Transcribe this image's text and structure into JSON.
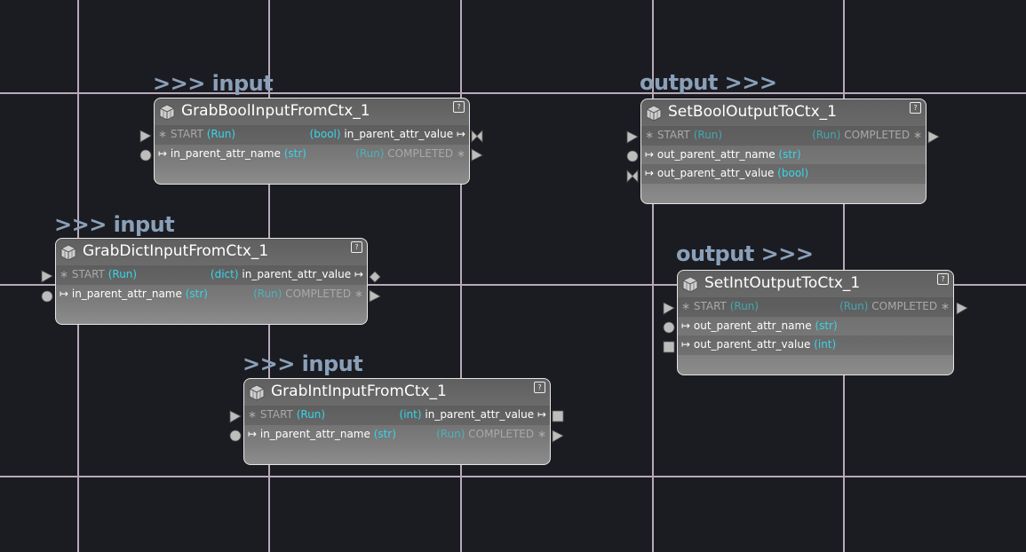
{
  "grid": {
    "color": "#b8a9ba",
    "background": "#1b1c22"
  },
  "nodes": [
    {
      "badge": ">>> input",
      "title": "GrabBoolInputFromCtx_1",
      "rows": [
        {
          "in_a": "∗ START",
          "in_b": "(Run)",
          "out_a": "(bool)",
          "out_b": "in_parent_attr_value ↦"
        },
        {
          "in_a": "↦ in_parent_attr_name",
          "in_b": "(str)",
          "out_a": "(Run)",
          "out_b": "COMPLETED ∗"
        }
      ]
    },
    {
      "badge": ">>> input",
      "title": "GrabDictInputFromCtx_1",
      "rows": [
        {
          "in_a": "∗ START",
          "in_b": "(Run)",
          "out_a": "(dict)",
          "out_b": "in_parent_attr_value ↦"
        },
        {
          "in_a": "↦ in_parent_attr_name",
          "in_b": "(str)",
          "out_a": "(Run)",
          "out_b": "COMPLETED ∗"
        }
      ]
    },
    {
      "badge": ">>> input",
      "title": "GrabIntInputFromCtx_1",
      "rows": [
        {
          "in_a": "∗ START",
          "in_b": "(Run)",
          "out_a": "(int)",
          "out_b": "in_parent_attr_value ↦"
        },
        {
          "in_a": "↦ in_parent_attr_name",
          "in_b": "(str)",
          "out_a": "(Run)",
          "out_b": "COMPLETED ∗"
        }
      ]
    },
    {
      "badge": "output >>>",
      "title": "SetBoolOutputToCtx_1",
      "rows": [
        {
          "in_a": "∗ START",
          "in_b": "(Run)",
          "out_a": "(Run)",
          "out_b": "COMPLETED ∗"
        },
        {
          "in_a": "↦ out_parent_attr_name",
          "in_b": "(str)",
          "out_a": "",
          "out_b": ""
        },
        {
          "in_a": "↦ out_parent_attr_value",
          "in_b": "(bool)",
          "out_a": "",
          "out_b": ""
        }
      ]
    },
    {
      "badge": "output >>>",
      "title": "SetIntOutputToCtx_1",
      "rows": [
        {
          "in_a": "∗ START",
          "in_b": "(Run)",
          "out_a": "(Run)",
          "out_b": "COMPLETED ∗"
        },
        {
          "in_a": "↦ out_parent_attr_name",
          "in_b": "(str)",
          "out_a": "",
          "out_b": ""
        },
        {
          "in_a": "↦ out_parent_attr_value",
          "in_b": "(int)",
          "out_a": "",
          "out_b": ""
        }
      ]
    }
  ],
  "help_icon": "?"
}
